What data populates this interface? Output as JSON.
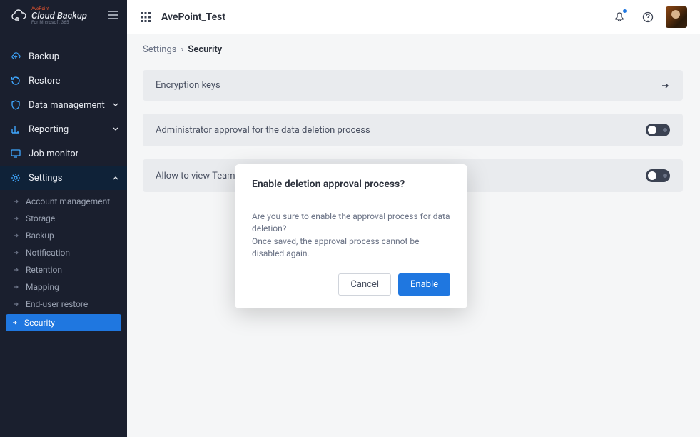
{
  "header": {
    "brand_top": "AvePoint",
    "brand_title": "Cloud Backup",
    "brand_sub": "For Microsoft 365",
    "org_name": "AvePoint_Test"
  },
  "sidebar": {
    "items": [
      {
        "label": "Backup",
        "icon": "cloud-up"
      },
      {
        "label": "Restore",
        "icon": "restore"
      },
      {
        "label": "Data management",
        "icon": "shield",
        "chevron": "down"
      },
      {
        "label": "Reporting",
        "icon": "chart",
        "chevron": "down"
      },
      {
        "label": "Job monitor",
        "icon": "monitor"
      },
      {
        "label": "Settings",
        "icon": "gear",
        "chevron": "up",
        "active": true
      }
    ],
    "settings_sub": [
      {
        "label": "Account management"
      },
      {
        "label": "Storage"
      },
      {
        "label": "Backup"
      },
      {
        "label": "Notification"
      },
      {
        "label": "Retention"
      },
      {
        "label": "Mapping"
      },
      {
        "label": "End-user restore"
      },
      {
        "label": "Security",
        "selected": true
      }
    ]
  },
  "breadcrumb": {
    "root": "Settings",
    "sep": "›",
    "current": "Security"
  },
  "cards": {
    "encryption": "Encryption keys",
    "admin_approval": "Administrator approval for the data deletion process",
    "teams_chat": "Allow to view Teams chat"
  },
  "modal": {
    "title": "Enable deletion approval process?",
    "body_line1": "Are you sure to enable the approval process for data deletion?",
    "body_line2": "Once saved, the approval process cannot be disabled again.",
    "cancel": "Cancel",
    "enable": "Enable"
  }
}
